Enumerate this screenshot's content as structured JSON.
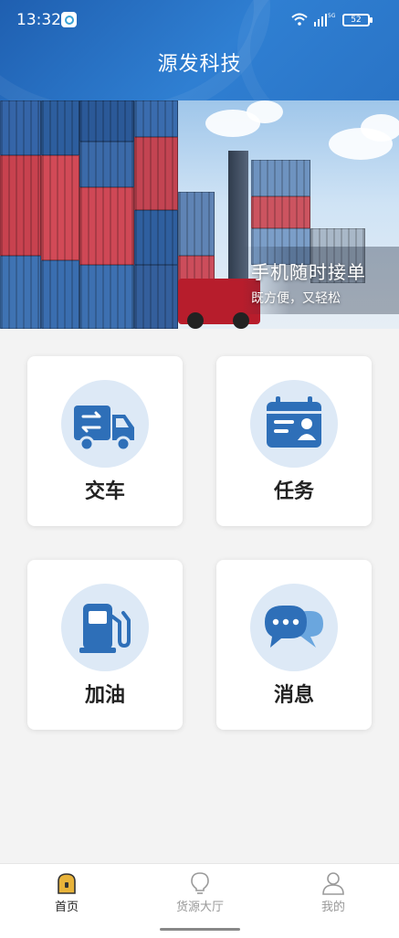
{
  "status_bar": {
    "time": "13:32",
    "signal_text": "5G",
    "battery": "52",
    "icons": [
      "app-icon",
      "wifi-icon",
      "signal-icon",
      "battery-icon"
    ]
  },
  "header": {
    "title": "源发科技",
    "color": "#2a74c6"
  },
  "banner": {
    "title": "手机随时接单",
    "subtitle": "既方便，又轻松"
  },
  "menu": {
    "items": [
      {
        "label": "交车",
        "icon": "truck-icon"
      },
      {
        "label": "任务",
        "icon": "calendar-card-icon"
      },
      {
        "label": "加油",
        "icon": "fuel-pump-icon"
      },
      {
        "label": "消息",
        "icon": "chat-bubbles-icon"
      }
    ],
    "icon_color": "#2e6fb8",
    "icon_bg": "#dde9f6"
  },
  "tabbar": {
    "tabs": [
      {
        "label": "首页",
        "icon": "home-icon",
        "active": true
      },
      {
        "label": "货源大厅",
        "icon": "lightbulb-icon",
        "active": false
      },
      {
        "label": "我的",
        "icon": "user-icon",
        "active": false
      }
    ],
    "active_color": "#e8b33a"
  }
}
